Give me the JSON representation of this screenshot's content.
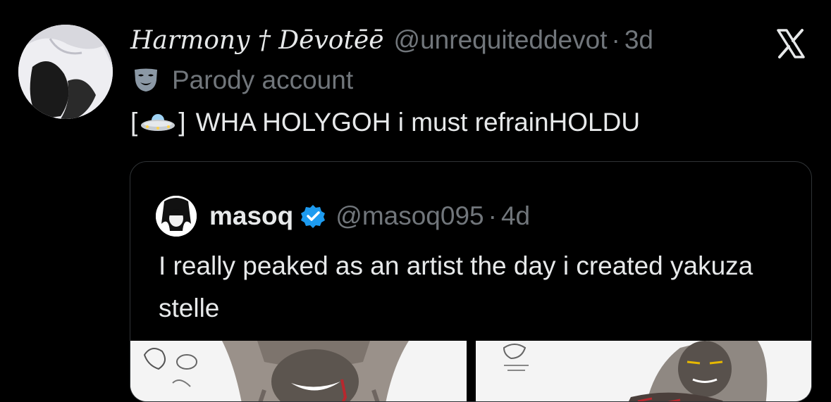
{
  "tweet": {
    "display_name": "Harmony † Dēvotēē",
    "handle": "@unrequiteddevot",
    "separator": "·",
    "time": "3d",
    "label": "Parody account",
    "text_prefix": "[",
    "text_bracket_close": "]",
    "text": "WHA HOLYGOH i must refrainHOLDU"
  },
  "quote": {
    "name": "masoq",
    "handle": "@masoq095",
    "separator": "·",
    "time": "4d",
    "text": "I really peaked as an artist the day i created yakuza stelle"
  },
  "icons": {
    "platform": "x-logo-icon",
    "label": "mask-icon",
    "emoji": "ufo-icon",
    "verified": "verified-badge-icon"
  },
  "colors": {
    "background": "#000000",
    "text": "#e7e9ea",
    "secondary": "#71767b",
    "verified": "#1d9bf0",
    "border": "#2f3336"
  }
}
